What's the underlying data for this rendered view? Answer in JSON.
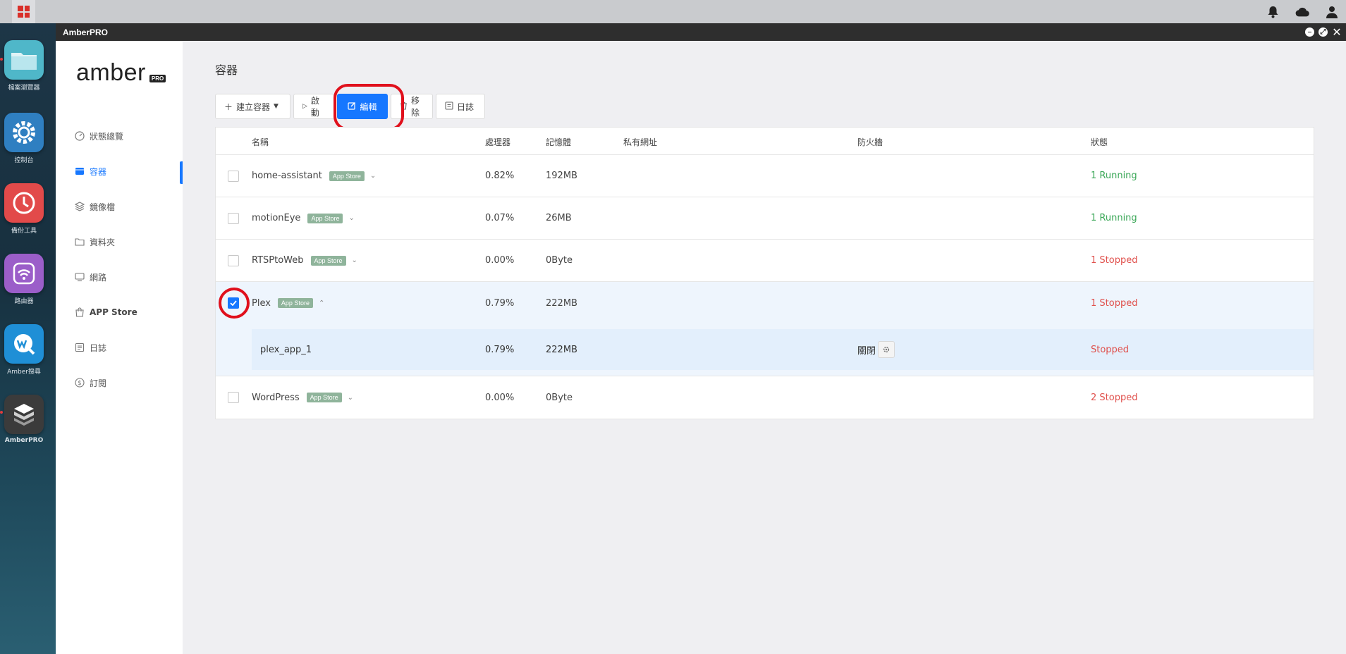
{
  "window": {
    "title": "AmberPRO"
  },
  "dock": [
    {
      "label": "檔案瀏覽器",
      "icon": "folder-icon",
      "color": "#4fb7c9"
    },
    {
      "label": "控制台",
      "icon": "gear-icon",
      "color": "#2f7fc1"
    },
    {
      "label": "備份工具",
      "icon": "backup-clock-icon",
      "color": "#e24a4a"
    },
    {
      "label": "路由器",
      "icon": "wifi-router-icon",
      "color": "#9b5ec9"
    },
    {
      "label": "Amber搜尋",
      "icon": "amber-search-icon",
      "color": "#1f8fd6"
    },
    {
      "label": "AmberPRO",
      "icon": "amberpro-box-icon",
      "color": "#3b3b3b"
    }
  ],
  "brand": {
    "word": "amber",
    "tag": "PRO"
  },
  "nav": [
    {
      "label": "狀態總覽",
      "icon": "dashboard-icon"
    },
    {
      "label": "容器",
      "icon": "container-icon",
      "active": true
    },
    {
      "label": "鏡像檔",
      "icon": "layers-icon"
    },
    {
      "label": "資料夾",
      "icon": "folder-outline-icon"
    },
    {
      "label": "網路",
      "icon": "monitor-icon"
    },
    {
      "label": "APP Store",
      "icon": "shopping-bag-icon"
    },
    {
      "label": "日誌",
      "icon": "log-icon"
    },
    {
      "label": "訂閱",
      "icon": "dollar-icon"
    }
  ],
  "page": {
    "title": "容器"
  },
  "toolbar": {
    "create": "建立容器",
    "start": "啟動",
    "edit": "編輯",
    "remove": "移除",
    "logs": "日誌"
  },
  "table": {
    "headers": {
      "name": "名稱",
      "cpu": "處理器",
      "memory": "記憶體",
      "private_url": "私有網址",
      "firewall": "防火牆",
      "status": "狀態"
    },
    "badge": "App Store",
    "rows": [
      {
        "name": "home-assistant",
        "cpu": "0.82%",
        "memory": "192MB",
        "status": "1 Running",
        "checked": false
      },
      {
        "name": "motionEye",
        "cpu": "0.07%",
        "memory": "26MB",
        "status": "1 Running",
        "checked": false
      },
      {
        "name": "RTSPtoWeb",
        "cpu": "0.00%",
        "memory": "0Byte",
        "status": "1 Stopped",
        "checked": false
      },
      {
        "name": "Plex",
        "cpu": "0.79%",
        "memory": "222MB",
        "status": "1 Stopped",
        "checked": true
      },
      {
        "name": "WordPress",
        "cpu": "0.00%",
        "memory": "0Byte",
        "status": "2 Stopped",
        "checked": false
      }
    ],
    "subrow": {
      "name": "plex_app_1",
      "cpu": "0.79%",
      "memory": "222MB",
      "firewall": "關閉",
      "status": "Stopped"
    }
  },
  "colors": {
    "accent": "#1677ff",
    "running": "#3aa757",
    "stopped": "#e0504c",
    "highlight": "#e0101c"
  }
}
